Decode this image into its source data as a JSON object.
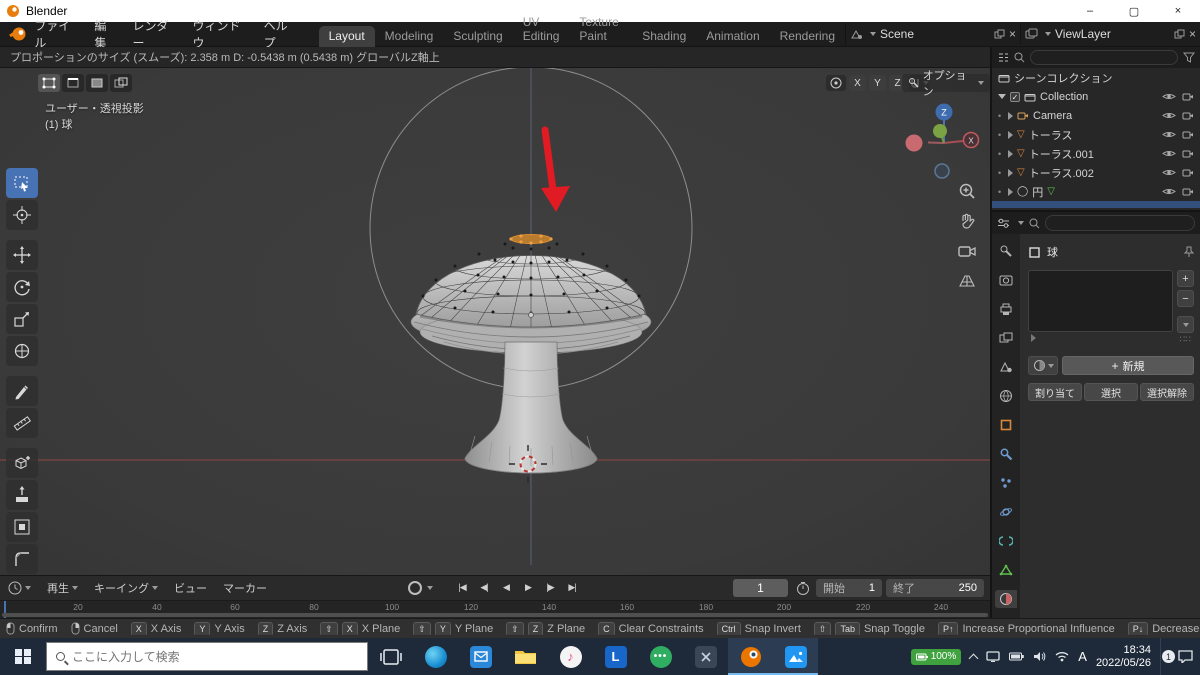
{
  "titlebar": {
    "title": "Blender"
  },
  "menubar": {
    "menus": [
      "ファイル",
      "編集",
      "レンダー",
      "ウィンドウ",
      "ヘルプ"
    ]
  },
  "workspaces": {
    "tabs": [
      "Layout",
      "Modeling",
      "Sculpting",
      "UV Editing",
      "Texture Paint",
      "Shading",
      "Animation",
      "Rendering"
    ],
    "active_tab": "Layout"
  },
  "scene_selector": {
    "scene": "Scene",
    "viewlayer": "ViewLayer"
  },
  "toolheader": {
    "info": "プロポーションのサイズ (スムーズ): 2.358 m    D: -0.5438 m (0.5438 m) グローバルZ軸上"
  },
  "viewport": {
    "view_mode": "ユーザー・透視投影",
    "selection_info": "(1) 球",
    "axis_x": "X",
    "axis_y": "Y",
    "axis_z": "Z",
    "options_label": "オプション",
    "gizmo_z": "Z",
    "gizmo_x": "X"
  },
  "outliner": {
    "scene_collection": "シーンコレクション",
    "collection": "Collection",
    "items": [
      {
        "name": "Camera",
        "icon": "camera"
      },
      {
        "name": "トーラス",
        "icon": "mesh"
      },
      {
        "name": "トーラス.001",
        "icon": "mesh"
      },
      {
        "name": "トーラス.002",
        "icon": "mesh"
      },
      {
        "name": "円",
        "icon": "mesh-edit"
      }
    ]
  },
  "properties": {
    "object": "球",
    "new_button": "新規",
    "assign_button": "割り当て",
    "select_button": "選択",
    "deselect_button": "選択解除"
  },
  "timeline": {
    "playback_menu": "再生",
    "keying_menu": "キーイング",
    "view_menu": "ビュー",
    "marker_menu": "マーカー",
    "current_frame": "1",
    "start_label": "開始",
    "start_value": "1",
    "end_label": "終了",
    "end_value": "250",
    "ruler": [
      "20",
      "40",
      "60",
      "80",
      "100",
      "120",
      "140",
      "160",
      "180",
      "200",
      "220",
      "240"
    ]
  },
  "statusbar": {
    "items": [
      {
        "mouse": "left",
        "label": "Confirm"
      },
      {
        "mouse": "right",
        "label": "Cancel"
      },
      {
        "keys": [
          "X"
        ],
        "label": "X Axis"
      },
      {
        "keys": [
          "Y"
        ],
        "label": "Y Axis"
      },
      {
        "keys": [
          "Z"
        ],
        "label": "Z Axis"
      },
      {
        "keys": [
          "⇧",
          "X"
        ],
        "label": "X Plane"
      },
      {
        "keys": [
          "⇧",
          "Y"
        ],
        "label": "Y Plane"
      },
      {
        "keys": [
          "⇧",
          "Z"
        ],
        "label": "Z Plane"
      },
      {
        "keys": [
          "C"
        ],
        "label": "Clear Constraints"
      },
      {
        "keys": [
          "Ctrl"
        ],
        "label": "Snap Invert"
      },
      {
        "keys": [
          "⇧",
          "Tab"
        ],
        "label": "Snap Toggle"
      },
      {
        "keys": [
          "P↑"
        ],
        "label": "Increase Proportional Influence"
      },
      {
        "keys": [
          "P↓"
        ],
        "label": "Decrease Prop"
      }
    ]
  },
  "taskbar": {
    "search_placeholder": "ここに入力して検索",
    "apps": [
      "task-view",
      "edge",
      "mail",
      "file-explorer",
      "music",
      "l-app",
      "chat",
      "dev-app",
      "blender",
      "photos"
    ],
    "battery": "100%",
    "ime": "A",
    "time": "18:34",
    "date": "2022/05/26",
    "notification_count": "1"
  }
}
